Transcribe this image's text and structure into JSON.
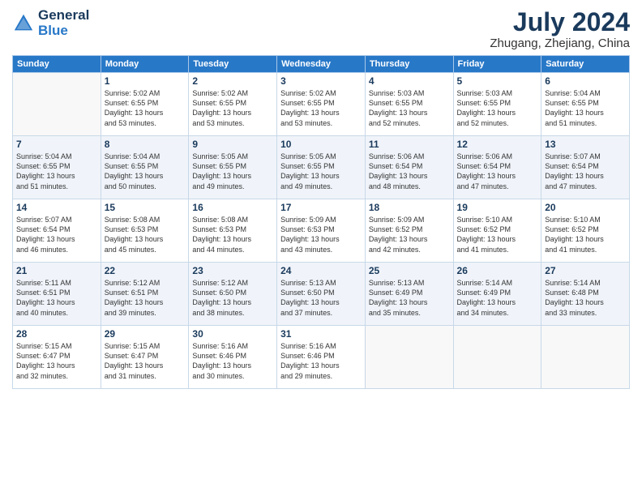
{
  "header": {
    "logo_line1": "General",
    "logo_line2": "Blue",
    "month_year": "July 2024",
    "location": "Zhugang, Zhejiang, China"
  },
  "weekdays": [
    "Sunday",
    "Monday",
    "Tuesday",
    "Wednesday",
    "Thursday",
    "Friday",
    "Saturday"
  ],
  "weeks": [
    [
      {
        "day": "",
        "info": ""
      },
      {
        "day": "1",
        "info": "Sunrise: 5:02 AM\nSunset: 6:55 PM\nDaylight: 13 hours\nand 53 minutes."
      },
      {
        "day": "2",
        "info": "Sunrise: 5:02 AM\nSunset: 6:55 PM\nDaylight: 13 hours\nand 53 minutes."
      },
      {
        "day": "3",
        "info": "Sunrise: 5:02 AM\nSunset: 6:55 PM\nDaylight: 13 hours\nand 53 minutes."
      },
      {
        "day": "4",
        "info": "Sunrise: 5:03 AM\nSunset: 6:55 PM\nDaylight: 13 hours\nand 52 minutes."
      },
      {
        "day": "5",
        "info": "Sunrise: 5:03 AM\nSunset: 6:55 PM\nDaylight: 13 hours\nand 52 minutes."
      },
      {
        "day": "6",
        "info": "Sunrise: 5:04 AM\nSunset: 6:55 PM\nDaylight: 13 hours\nand 51 minutes."
      }
    ],
    [
      {
        "day": "7",
        "info": "Sunrise: 5:04 AM\nSunset: 6:55 PM\nDaylight: 13 hours\nand 51 minutes."
      },
      {
        "day": "8",
        "info": "Sunrise: 5:04 AM\nSunset: 6:55 PM\nDaylight: 13 hours\nand 50 minutes."
      },
      {
        "day": "9",
        "info": "Sunrise: 5:05 AM\nSunset: 6:55 PM\nDaylight: 13 hours\nand 49 minutes."
      },
      {
        "day": "10",
        "info": "Sunrise: 5:05 AM\nSunset: 6:55 PM\nDaylight: 13 hours\nand 49 minutes."
      },
      {
        "day": "11",
        "info": "Sunrise: 5:06 AM\nSunset: 6:54 PM\nDaylight: 13 hours\nand 48 minutes."
      },
      {
        "day": "12",
        "info": "Sunrise: 5:06 AM\nSunset: 6:54 PM\nDaylight: 13 hours\nand 47 minutes."
      },
      {
        "day": "13",
        "info": "Sunrise: 5:07 AM\nSunset: 6:54 PM\nDaylight: 13 hours\nand 47 minutes."
      }
    ],
    [
      {
        "day": "14",
        "info": "Sunrise: 5:07 AM\nSunset: 6:54 PM\nDaylight: 13 hours\nand 46 minutes."
      },
      {
        "day": "15",
        "info": "Sunrise: 5:08 AM\nSunset: 6:53 PM\nDaylight: 13 hours\nand 45 minutes."
      },
      {
        "day": "16",
        "info": "Sunrise: 5:08 AM\nSunset: 6:53 PM\nDaylight: 13 hours\nand 44 minutes."
      },
      {
        "day": "17",
        "info": "Sunrise: 5:09 AM\nSunset: 6:53 PM\nDaylight: 13 hours\nand 43 minutes."
      },
      {
        "day": "18",
        "info": "Sunrise: 5:09 AM\nSunset: 6:52 PM\nDaylight: 13 hours\nand 42 minutes."
      },
      {
        "day": "19",
        "info": "Sunrise: 5:10 AM\nSunset: 6:52 PM\nDaylight: 13 hours\nand 41 minutes."
      },
      {
        "day": "20",
        "info": "Sunrise: 5:10 AM\nSunset: 6:52 PM\nDaylight: 13 hours\nand 41 minutes."
      }
    ],
    [
      {
        "day": "21",
        "info": "Sunrise: 5:11 AM\nSunset: 6:51 PM\nDaylight: 13 hours\nand 40 minutes."
      },
      {
        "day": "22",
        "info": "Sunrise: 5:12 AM\nSunset: 6:51 PM\nDaylight: 13 hours\nand 39 minutes."
      },
      {
        "day": "23",
        "info": "Sunrise: 5:12 AM\nSunset: 6:50 PM\nDaylight: 13 hours\nand 38 minutes."
      },
      {
        "day": "24",
        "info": "Sunrise: 5:13 AM\nSunset: 6:50 PM\nDaylight: 13 hours\nand 37 minutes."
      },
      {
        "day": "25",
        "info": "Sunrise: 5:13 AM\nSunset: 6:49 PM\nDaylight: 13 hours\nand 35 minutes."
      },
      {
        "day": "26",
        "info": "Sunrise: 5:14 AM\nSunset: 6:49 PM\nDaylight: 13 hours\nand 34 minutes."
      },
      {
        "day": "27",
        "info": "Sunrise: 5:14 AM\nSunset: 6:48 PM\nDaylight: 13 hours\nand 33 minutes."
      }
    ],
    [
      {
        "day": "28",
        "info": "Sunrise: 5:15 AM\nSunset: 6:47 PM\nDaylight: 13 hours\nand 32 minutes."
      },
      {
        "day": "29",
        "info": "Sunrise: 5:15 AM\nSunset: 6:47 PM\nDaylight: 13 hours\nand 31 minutes."
      },
      {
        "day": "30",
        "info": "Sunrise: 5:16 AM\nSunset: 6:46 PM\nDaylight: 13 hours\nand 30 minutes."
      },
      {
        "day": "31",
        "info": "Sunrise: 5:16 AM\nSunset: 6:46 PM\nDaylight: 13 hours\nand 29 minutes."
      },
      {
        "day": "",
        "info": ""
      },
      {
        "day": "",
        "info": ""
      },
      {
        "day": "",
        "info": ""
      }
    ]
  ]
}
